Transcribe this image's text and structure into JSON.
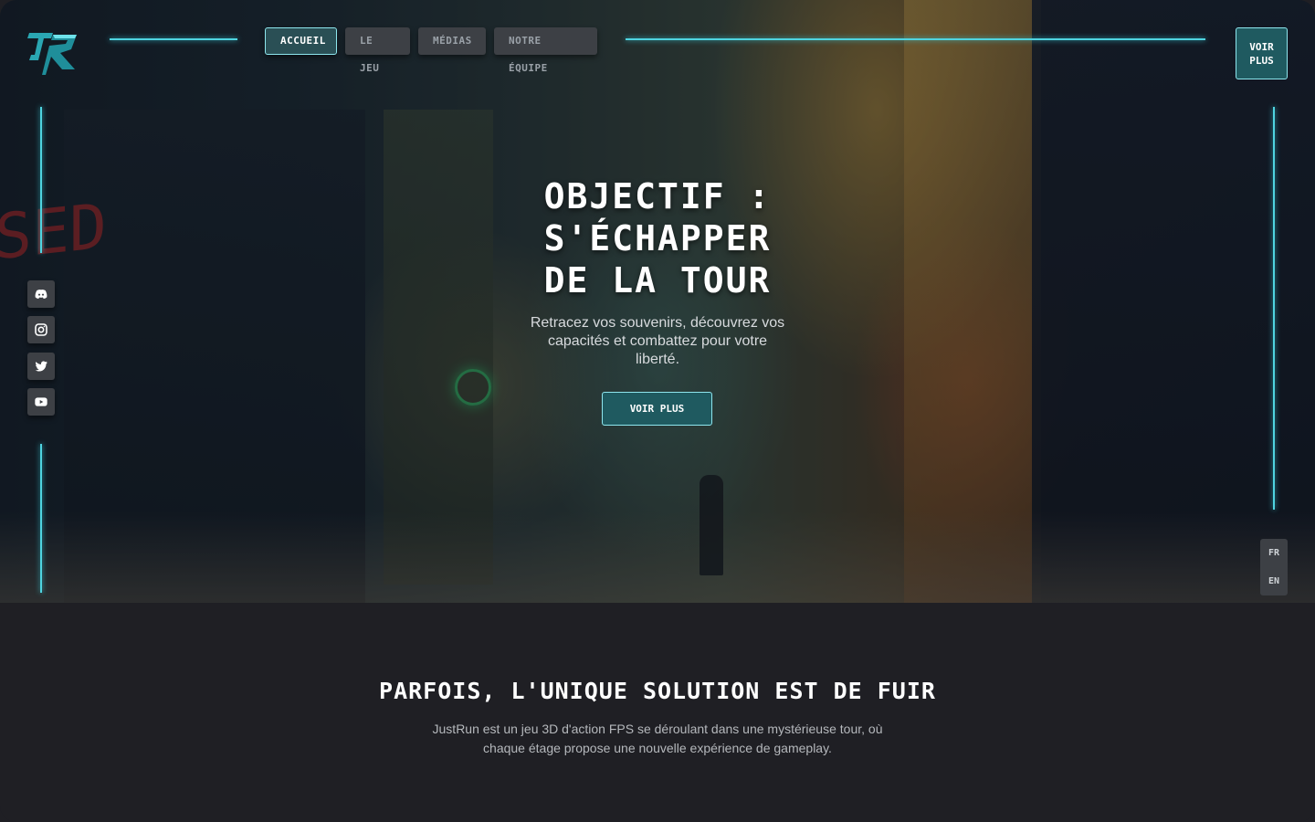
{
  "nav": {
    "items": [
      {
        "label": "Accueil",
        "active": true
      },
      {
        "label": "Le jeu",
        "active": false
      },
      {
        "label": "Médias",
        "active": false
      },
      {
        "label": "Notre équipe",
        "active": false
      }
    ],
    "cta_label": "Voir plus"
  },
  "hero": {
    "title_line1": "OBJECTIF :",
    "title_line2": "S'ÉCHAPPER",
    "title_line3": "DE LA TOUR",
    "subtitle": "Retracez vos souvenirs, découvrez vos capacités et combattez pour votre liberté.",
    "cta_label": "Voir plus",
    "background_sign_text": "SED"
  },
  "social": [
    "discord-icon",
    "instagram-icon",
    "twitter-icon",
    "youtube-icon"
  ],
  "languages": [
    "FR",
    "EN"
  ],
  "section2": {
    "title": "PARFOIS, L'UNIQUE SOLUTION EST DE FUIR",
    "text": "JustRun est un jeu 3D d'action FPS se déroulant dans une mystérieuse tour, où chaque étage propose une nouvelle expérience de gameplay."
  },
  "colors": {
    "accent": "#4fd4e0",
    "button_bg": "#3d4045",
    "cta_bg": "#1f5a60",
    "page_bg": "#1f1f24"
  }
}
